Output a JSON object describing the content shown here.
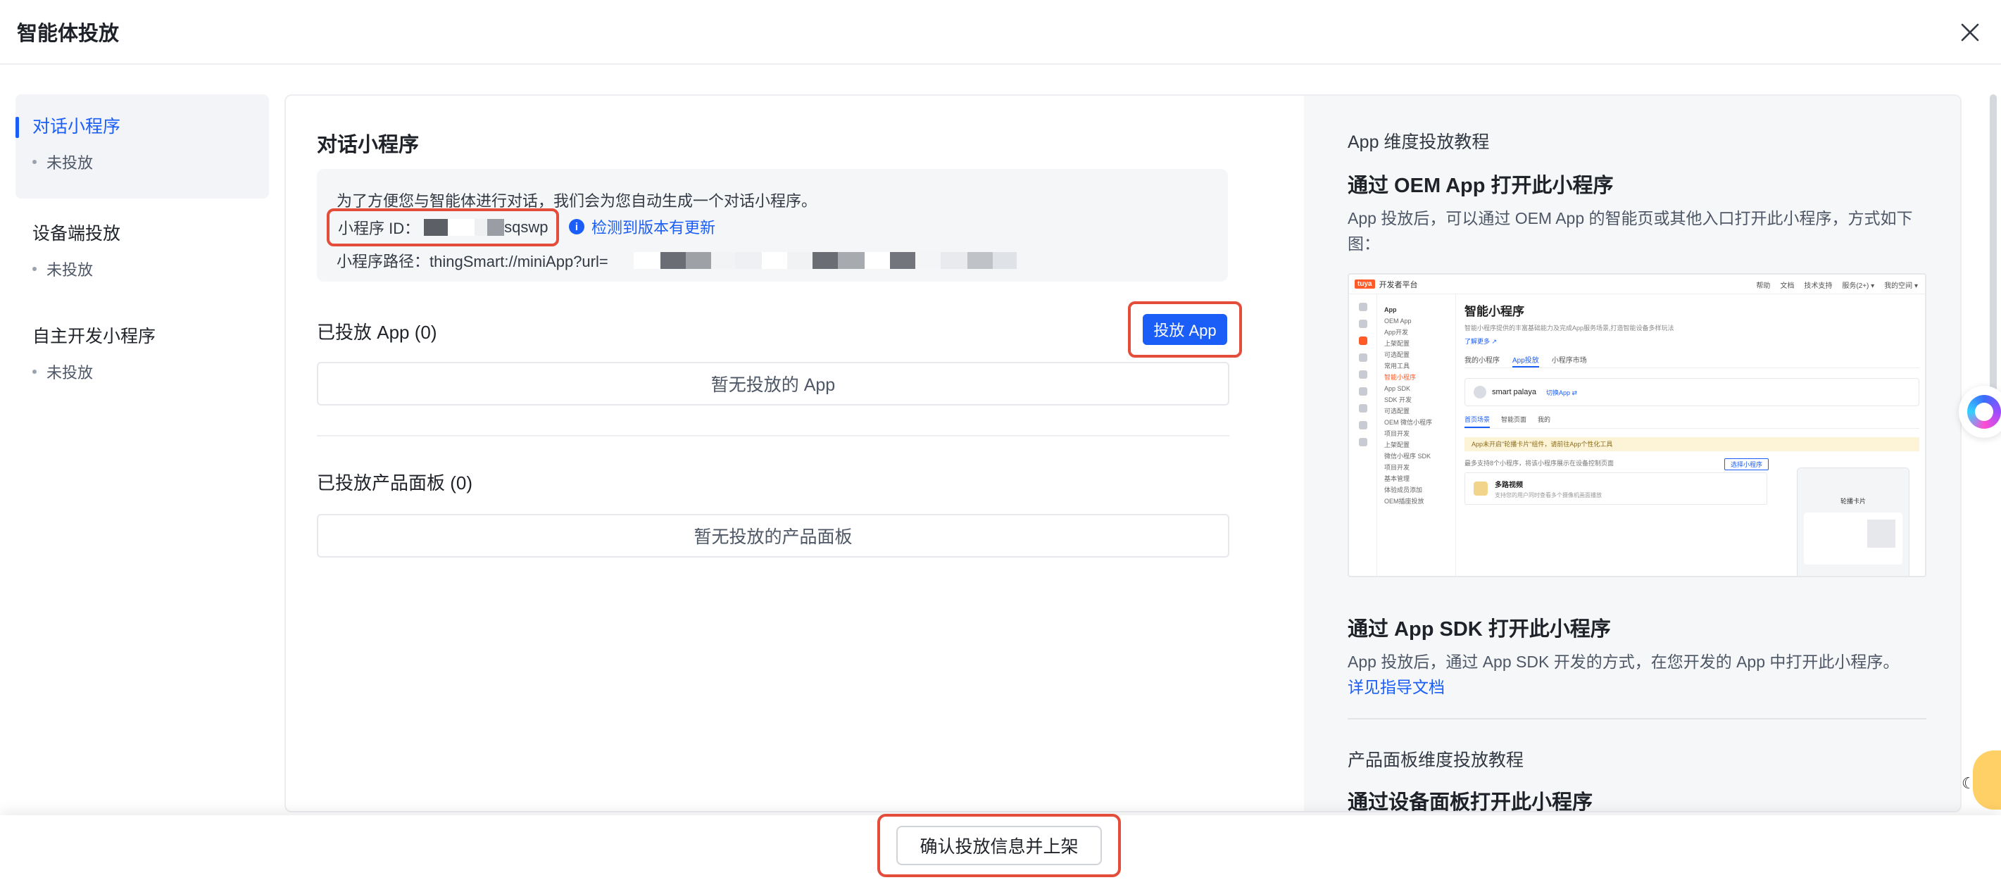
{
  "header": {
    "title": "智能体投放"
  },
  "sidebar": {
    "items": [
      {
        "label": "对话小程序",
        "status": "未投放",
        "active": true
      },
      {
        "label": "设备端投放",
        "status": "未投放",
        "active": false
      },
      {
        "label": "自主开发小程序",
        "status": "未投放",
        "active": false
      }
    ]
  },
  "main": {
    "section_title": "对话小程序",
    "info": {
      "intro": "为了方便您与智能体进行对话，我们会为您自动生成一个对话小程序。",
      "id_label": "小程序 ID：",
      "id_suffix": "sqswp",
      "check_update": "检测到版本有更新",
      "path_label": "小程序路径：thingSmart://miniApp?url="
    },
    "deployed_app": {
      "title": "已投放 App (0)",
      "button": "投放 App",
      "empty": "暂无投放的 App"
    },
    "deployed_panel": {
      "title": "已投放产品面板 (0)",
      "empty": "暂无投放的产品面板"
    }
  },
  "tutorial": {
    "app_section_sub": "App 维度投放教程",
    "oem_title": "通过 OEM App 打开此小程序",
    "oem_desc": "App 投放后，可以通过 OEM App 的智能页或其他入口打开此小程序，方式如下图：",
    "sdk_title": "通过 App SDK 打开此小程序",
    "sdk_desc": "App 投放后，通过 App SDK 开发的方式，在您开发的 App 中打开此小程序。",
    "sdk_link": "详见指导文档",
    "panel_section_sub": "产品面板维度投放教程",
    "panel_title": "通过设备面板打开此小程序",
    "screenshot": {
      "logo": "tuya",
      "platform": "开发者平台",
      "topnav": [
        "帮助",
        "文档",
        "技术支持",
        "服务(2+) ▾",
        "我的空间 ▾"
      ],
      "menu": [
        "App",
        "OEM App",
        "App开发",
        "上架配置",
        "可选配置",
        "常用工具",
        "智能小程序",
        "App SDK",
        "SDK 开发",
        "可选配置",
        "OEM 微信小程序",
        "项目开发",
        "上架配置",
        "微信小程序 SDK",
        "项目开发",
        "基本管理",
        "体验成员添加",
        "OEM插座投放"
      ],
      "title": "智能小程序",
      "desc": "智能小程序提供的丰富基础能力及完成App服务场景,打造智能设备多样玩法",
      "more": "了解更多 ↗",
      "tabs": [
        "我的小程序",
        "App投放",
        "小程序市场"
      ],
      "app_name": "smart palaya",
      "switch_app": "切换App ⇄",
      "subtabs": [
        "首页场景",
        "智能页面",
        "我的"
      ],
      "warning": "App未开启\"轮播卡片\"组件，请前往App个性化工具",
      "hint": "最多支持8个小程序，将该小程序展示在设备控制页面",
      "select_button": "选择小程序",
      "item_title": "多路视频",
      "item_desc": "支持您的用户同时查看多个摄像机画面播放",
      "phone_title": "轮播卡片"
    }
  }
}
